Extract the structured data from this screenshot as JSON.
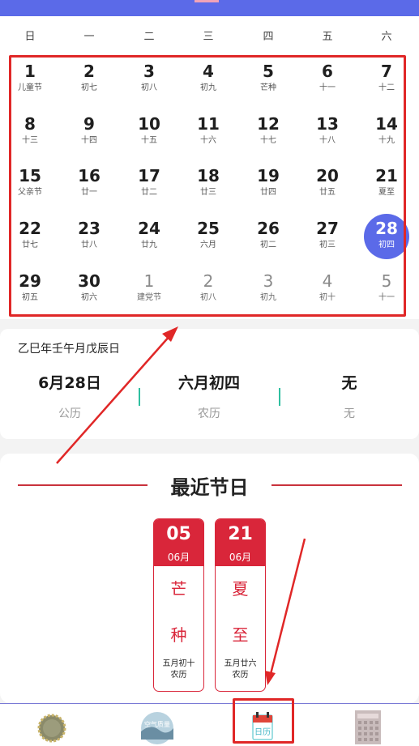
{
  "weekdays": [
    "日",
    "一",
    "二",
    "三",
    "四",
    "五",
    "六"
  ],
  "days": [
    {
      "num": "1",
      "lunar": "儿童节"
    },
    {
      "num": "2",
      "lunar": "初七"
    },
    {
      "num": "3",
      "lunar": "初八"
    },
    {
      "num": "4",
      "lunar": "初九"
    },
    {
      "num": "5",
      "lunar": "芒种"
    },
    {
      "num": "6",
      "lunar": "十一"
    },
    {
      "num": "7",
      "lunar": "十二"
    },
    {
      "num": "8",
      "lunar": "十三"
    },
    {
      "num": "9",
      "lunar": "十四"
    },
    {
      "num": "10",
      "lunar": "十五"
    },
    {
      "num": "11",
      "lunar": "十六"
    },
    {
      "num": "12",
      "lunar": "十七"
    },
    {
      "num": "13",
      "lunar": "十八"
    },
    {
      "num": "14",
      "lunar": "十九"
    },
    {
      "num": "15",
      "lunar": "父亲节"
    },
    {
      "num": "16",
      "lunar": "廿一"
    },
    {
      "num": "17",
      "lunar": "廿二"
    },
    {
      "num": "18",
      "lunar": "廿三"
    },
    {
      "num": "19",
      "lunar": "廿四"
    },
    {
      "num": "20",
      "lunar": "廿五"
    },
    {
      "num": "21",
      "lunar": "夏至"
    },
    {
      "num": "22",
      "lunar": "廿七"
    },
    {
      "num": "23",
      "lunar": "廿八"
    },
    {
      "num": "24",
      "lunar": "廿九"
    },
    {
      "num": "25",
      "lunar": "六月"
    },
    {
      "num": "26",
      "lunar": "初二"
    },
    {
      "num": "27",
      "lunar": "初三"
    },
    {
      "num": "28",
      "lunar": "初四"
    },
    {
      "num": "29",
      "lunar": "初五"
    },
    {
      "num": "30",
      "lunar": "初六"
    },
    {
      "num": "1",
      "lunar": "建党节"
    },
    {
      "num": "2",
      "lunar": "初八"
    },
    {
      "num": "3",
      "lunar": "初九"
    },
    {
      "num": "4",
      "lunar": "初十"
    },
    {
      "num": "5",
      "lunar": "十一"
    }
  ],
  "selected_day": "28",
  "info": {
    "title": "乙巳年壬午月戊辰日",
    "solar_value": "6月28日",
    "solar_label": "公历",
    "lunar_value": "六月初四",
    "lunar_label": "农历",
    "festival_value": "无",
    "festival_label": "无"
  },
  "festivals": {
    "heading": "最近节日",
    "cards": [
      {
        "day": "05",
        "month": "06月",
        "char1": "芒",
        "char2": "种",
        "lunar": "五月初十",
        "label": "农历"
      },
      {
        "day": "21",
        "month": "06月",
        "char1": "夏",
        "char2": "至",
        "lunar": "五月廿六",
        "label": "农历"
      }
    ]
  },
  "nav": [
    "weather-icon",
    "air-quality-icon",
    "calendar-icon",
    "building-icon"
  ],
  "nav_text": {
    "air": "空气质量",
    "calendar": "日历"
  },
  "colors": {
    "accent": "#5b6ae8",
    "festival_red": "#d9263a",
    "annotation_red": "#e02727",
    "separator": "#2fbfa0"
  }
}
